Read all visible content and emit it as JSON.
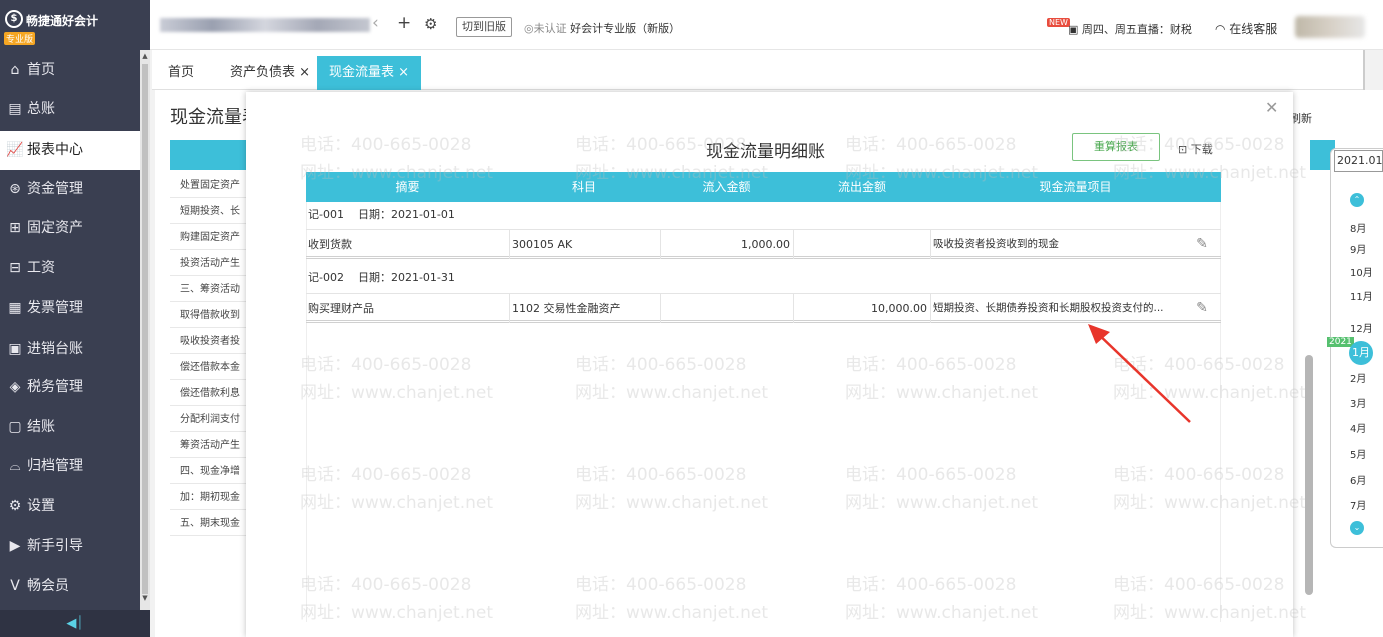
{
  "app": {
    "logo_text": "畅捷通好会计",
    "edition_badge": "专业版"
  },
  "topbar": {
    "switch_old_label": "切到旧版",
    "cert_status": "未认证",
    "product_name": "好会计专业版（新版）",
    "new_badge": "NEW",
    "live_text": "周四、周五直播：财税",
    "service_label": "在线客服"
  },
  "sidebar": {
    "items": [
      {
        "label": "首页",
        "icon": "home-icon"
      },
      {
        "label": "总账",
        "icon": "ledger-icon"
      },
      {
        "label": "报表中心",
        "icon": "chart-icon"
      },
      {
        "label": "资金管理",
        "icon": "money-icon"
      },
      {
        "label": "固定资产",
        "icon": "asset-icon"
      },
      {
        "label": "工资",
        "icon": "salary-icon"
      },
      {
        "label": "发票管理",
        "icon": "invoice-icon"
      },
      {
        "label": "进销台账",
        "icon": "inventory-icon"
      },
      {
        "label": "税务管理",
        "icon": "tax-icon"
      },
      {
        "label": "结账",
        "icon": "close-books-icon"
      },
      {
        "label": "归档管理",
        "icon": "archive-icon"
      },
      {
        "label": "设置",
        "icon": "gear-icon"
      },
      {
        "label": "新手引导",
        "icon": "guide-icon"
      },
      {
        "label": "畅会员",
        "icon": "member-icon"
      }
    ],
    "active_index": 2
  },
  "tabs": [
    {
      "label": "首页"
    },
    {
      "label": "资产负债表 ×"
    },
    {
      "label": "现金流量表 ×"
    }
  ],
  "background_page": {
    "title": "现金流量表",
    "refresh_label": "刷新",
    "rows": [
      "处置固定资产",
      "短期投资、长",
      "购建固定资产",
      "投资活动产生",
      "三、筹资活动",
      "取得借款收到",
      "吸收投资者投",
      "偿还借款本金",
      "偿还借款利息",
      "分配利润支付",
      "筹资活动产生",
      "四、现金净增",
      "加：期初现金",
      "五、期末现金"
    ]
  },
  "date_picker": {
    "period": "2021.01",
    "year_tag": "2021",
    "months": [
      "8月",
      "9月",
      "10月",
      "11月",
      "12月",
      "1月",
      "2月",
      "3月",
      "4月",
      "5月",
      "6月",
      "7月"
    ],
    "current_month": "1月"
  },
  "modal": {
    "title": "现金流量明细账",
    "recalc_label": "重算报表",
    "download_label": "下载",
    "columns": [
      "摘要",
      "科目",
      "流入金额",
      "流出金额",
      "现金流量项目"
    ],
    "vouchers": [
      {
        "no": "记-001",
        "date": "日期：2021-01-01",
        "rows": [
          {
            "summary": "收到货款",
            "account": "300105 AK",
            "inflow": "1,000.00",
            "outflow": "",
            "item": "吸收投资者投资收到的现金"
          }
        ]
      },
      {
        "no": "记-002",
        "date": "日期：2021-01-31",
        "rows": [
          {
            "summary": "购买理财产品",
            "account": "1102 交易性金融资产",
            "inflow": "",
            "outflow": "10,000.00",
            "item": "短期投资、长期债券投资和长期股权投资支付的..."
          }
        ]
      }
    ]
  },
  "watermark": {
    "phone": "电话：400-665-0028",
    "site": "网址：www.chanjet.net"
  },
  "colors": {
    "accent": "#3dbfd9",
    "sidebar_bg": "#3a3f51",
    "annotation_arrow": "#e8352b"
  }
}
